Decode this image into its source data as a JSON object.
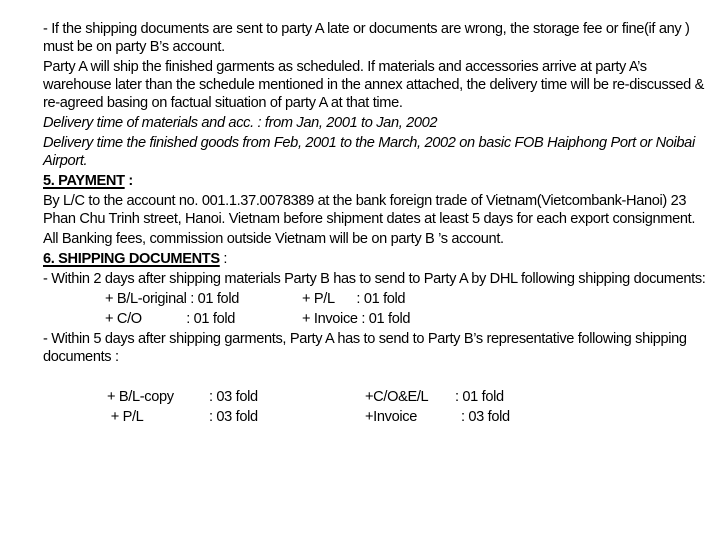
{
  "document": {
    "para_late_docs": " - If the shipping documents are sent to party A late or documents are wrong, the storage fee or fine(if any ) must be on party B’s account.",
    "para_ship_schedule": "Party A will ship the finished garments as scheduled. If materials and accessories arrive at party A’s warehouse later than the schedule mentioned in the annex attached, the delivery time will be re-discussed & re-agreed basing on factual situation of party A at that time.",
    "delivery_materials": " Delivery time of materials and acc. : from Jan, 2001 to Jan, 2002",
    "delivery_goods": " Delivery time the finished goods from Feb, 2001 to the March, 2002 on basic FOB Haiphong Port or Noibai Airport.",
    "payment": {
      "heading": "5. PAYMENT",
      "heading_suffix": " :",
      "para_lc": "By L/C  to the account no. 001.1.37.0078389 at the bank foreign trade of Vietnam(Vietcombank-Hanoi) 23 Phan Chu Trinh street, Hanoi. Vietnam before shipment dates at least 5 days for each export consignment.",
      "para_fees": "All Banking fees, commission outside Vietnam will be on party B ’s account."
    },
    "shipping": {
      "heading": "6. SHIPPING DOCUMENTS",
      "heading_suffix": " :",
      "within2": "- Within 2 days after shipping materials Party B has to send to Party A by DHL following shipping documents:",
      "list1": [
        {
          "left": "+ B/L-original : 01 fold",
          "right": "+ P/L      : 01 fold"
        },
        {
          "left": "+ C/O            : 01 fold",
          "right": "+ Invoice : 01 fold"
        }
      ],
      "within5": "- Within 5 days after shipping garments, Party A has to send to Party B’s representative following shipping documents :",
      "list2": [
        {
          "c1": "+ B/L-copy",
          "c2": ": 03 fold",
          "c3": "+C/O&E/L",
          "c4": ": 01 fold"
        },
        {
          "c1": " + P/L",
          "c2": ": 03 fold",
          "c3": "+Invoice",
          "c4": ": 03 fold"
        }
      ]
    }
  }
}
